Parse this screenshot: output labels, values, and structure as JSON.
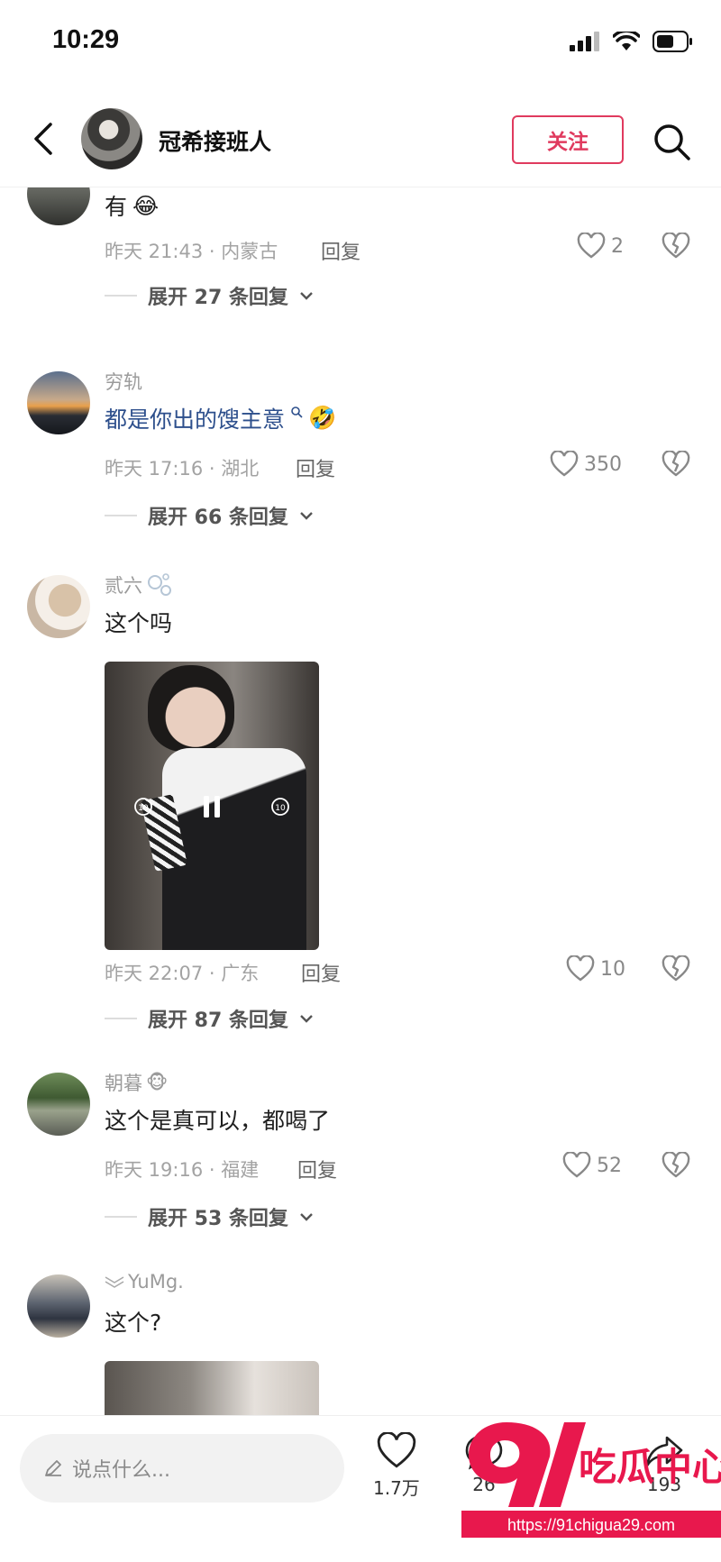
{
  "status_bar": {
    "time": "10:29"
  },
  "header": {
    "name": "冠希接班人",
    "follow_label": "关注"
  },
  "comments": [
    {
      "username": "",
      "text": "有",
      "emoji": "😂",
      "time_location": "昨天 21:43 · 内蒙古",
      "reply_label": "回复",
      "likes": "2",
      "expand_label": "展开 27 条回复"
    },
    {
      "username": "穷轨",
      "text": "都是你出的馊主意",
      "emoji": "🤣",
      "time_location": "昨天 17:16 · 湖北",
      "reply_label": "回复",
      "likes": "350",
      "expand_label": "展开 66 条回复"
    },
    {
      "username": "贰六",
      "text": "这个吗",
      "time_location": "昨天 22:07 · 广东",
      "reply_label": "回复",
      "likes": "10",
      "expand_label": "展开 87 条回复"
    },
    {
      "username": "朝暮",
      "username_emoji": "🐵",
      "text": "这个是真可以，都喝了",
      "time_location": "昨天 19:16 · 福建",
      "reply_label": "回复",
      "likes": "52",
      "expand_label": "展开 53 条回复"
    },
    {
      "username": "YuMg.",
      "text": "这个?"
    }
  ],
  "bottom_bar": {
    "placeholder": "说点什么...",
    "like_count": "1.7万",
    "comment_count": "26",
    "share_count": "193"
  },
  "watermark": {
    "logo": "91",
    "text": "吃瓜中心",
    "url": "https://91chigua29.com"
  },
  "colors": {
    "accent": "#e03a5e",
    "link": "#2d4f8c",
    "watermark": "#e8184d"
  }
}
